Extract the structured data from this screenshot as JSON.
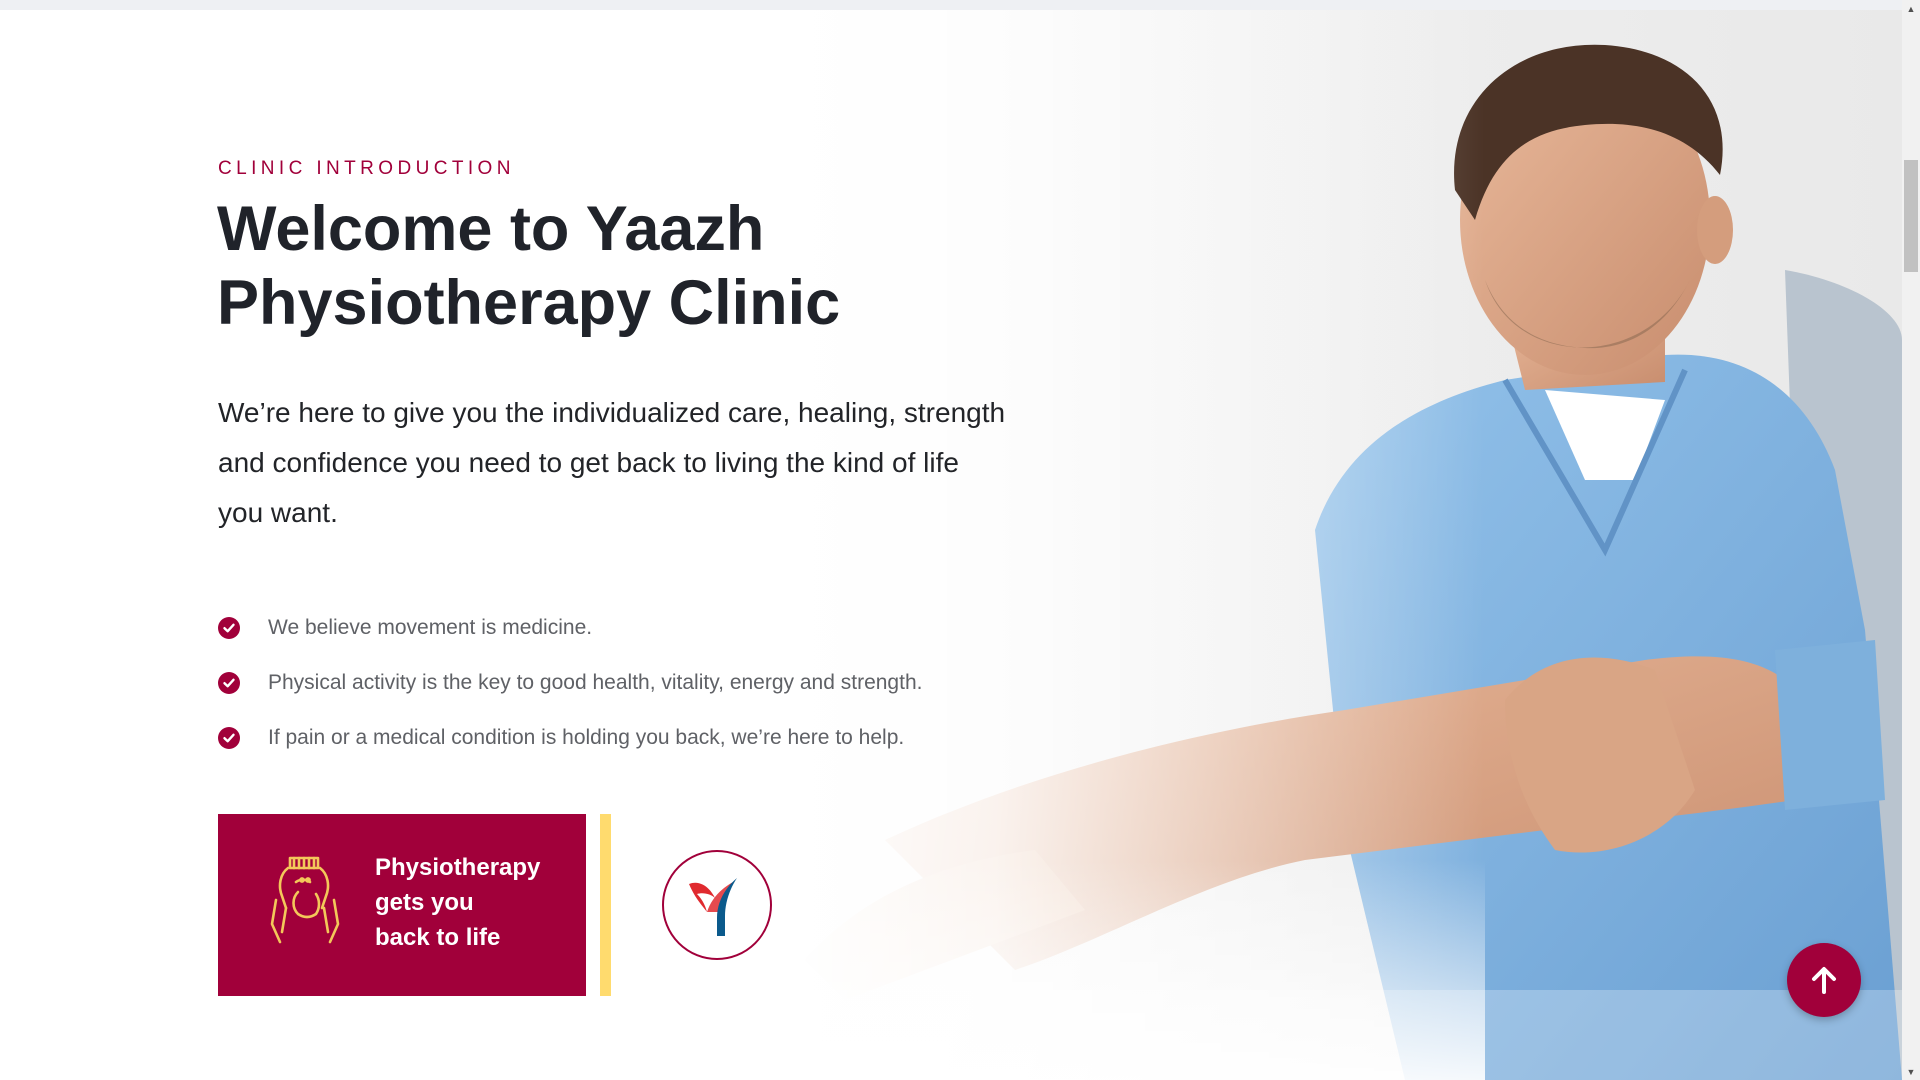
{
  "hero": {
    "eyebrow": "CLINIC INTRODUCTION",
    "title": "Welcome to Yaazh Physiotherapy Clinic",
    "lead": "We’re here to give you the individualized care, healing, strength and confidence you need to get back to living the kind of life you want."
  },
  "checklist": [
    {
      "text": "We believe movement is medicine.",
      "icon": "check-circle-icon"
    },
    {
      "text": "Physical activity is the key to good health, vitality, energy and strength.",
      "icon": "check-circle-icon"
    },
    {
      "text": "If pain or a medical condition is holding you back, we’re here to help.",
      "icon": "check-circle-icon"
    }
  ],
  "feature": {
    "icon": "fist-hand-icon",
    "line1": "Physiotherapy",
    "line2": "gets you",
    "line3": "back to life"
  },
  "logo": {
    "icon": "yaazh-logo-icon"
  },
  "back_to_top": {
    "icon": "arrow-up-icon"
  },
  "colors": {
    "accent": "#a1003a",
    "highlight": "#ffdb6e",
    "heading": "#20232a",
    "body_text": "#5f6166",
    "scrubs": "#7fb3e0"
  }
}
